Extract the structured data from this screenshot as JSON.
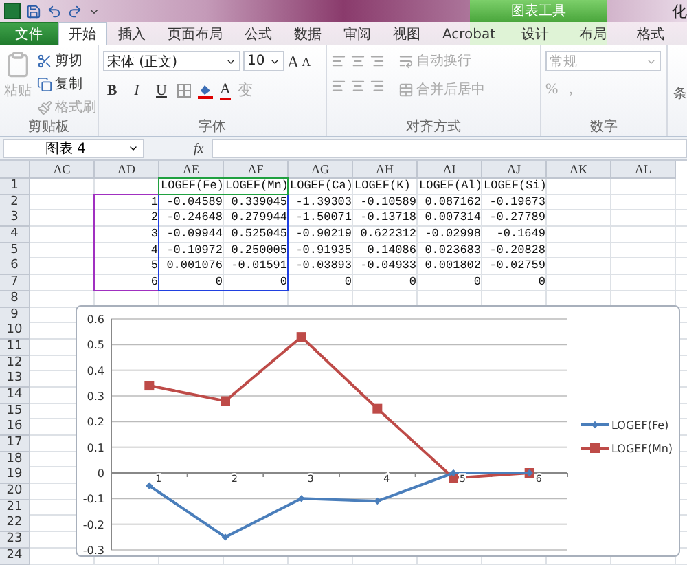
{
  "window": {
    "title": "化"
  },
  "context_tab_group": {
    "label": "图表工具"
  },
  "tabs": [
    {
      "label": "文件",
      "kind": "file",
      "selected": false
    },
    {
      "label": "开始",
      "kind": "normal",
      "selected": true
    },
    {
      "label": "插入",
      "kind": "normal",
      "selected": false
    },
    {
      "label": "页面布局",
      "kind": "normal",
      "selected": false
    },
    {
      "label": "公式",
      "kind": "normal",
      "selected": false
    },
    {
      "label": "数据",
      "kind": "normal",
      "selected": false
    },
    {
      "label": "审阅",
      "kind": "normal",
      "selected": false
    },
    {
      "label": "视图",
      "kind": "normal",
      "selected": false
    },
    {
      "label": "Acrobat",
      "kind": "normal",
      "selected": false
    },
    {
      "label": "设计",
      "kind": "context",
      "selected": false
    },
    {
      "label": "布局",
      "kind": "context",
      "selected": false
    },
    {
      "label": "格式",
      "kind": "context",
      "selected": false
    }
  ],
  "ribbon": {
    "clipboard": {
      "label": "剪贴板",
      "paste": {
        "label": "粘贴",
        "disabled": true
      },
      "items": [
        {
          "label": "剪切",
          "kind": "cut",
          "disabled": false
        },
        {
          "label": "复制",
          "kind": "copy",
          "disabled": false
        },
        {
          "label": "格式刷",
          "kind": "painter",
          "disabled": true
        }
      ]
    },
    "font": {
      "label": "字体",
      "font_name": "宋体 (正文)",
      "font_size": "10",
      "styles": [
        {
          "label": "B",
          "kind": "bold"
        },
        {
          "label": "I",
          "kind": "italic"
        },
        {
          "label": "U",
          "kind": "underline"
        }
      ],
      "grow": "A",
      "shrink": "A",
      "font_color": "A",
      "phonetic": {
        "label": "变",
        "disabled": true
      }
    },
    "alignment": {
      "label": "对齐方式",
      "wrap": {
        "label": "自动换行",
        "disabled": true
      },
      "merge": {
        "label": "合并后居中",
        "disabled": true
      }
    },
    "number": {
      "label": "数字",
      "format": {
        "label": "常规",
        "disabled": true
      },
      "percent": "%",
      "comma": ","
    },
    "partial_group_label": "条"
  },
  "formula_bar": {
    "name_box": "图表 4",
    "function_label": "fx"
  },
  "sheet": {
    "columns": [
      "AC",
      "AD",
      "AE",
      "AF",
      "AG",
      "AH",
      "AI",
      "AJ",
      "AK",
      "AL"
    ],
    "rows": [
      {
        "number": "1",
        "labels": [
          "LOGEF(Fe)",
          "LOGEF(Mn)",
          "LOGEF(Ca)",
          "LOGEF(K)",
          "LOGEF(Al)",
          "LOGEF(Si)"
        ]
      },
      {
        "number": "2",
        "category": "1",
        "values": [
          "-0.04589",
          "0.339045",
          "-1.39303",
          "-0.10589",
          "0.087162",
          "-0.19673"
        ]
      },
      {
        "number": "3",
        "category": "2",
        "values": [
          "-0.24648",
          "0.279944",
          "-1.50071",
          "-0.13718",
          "0.007314",
          "-0.27789"
        ]
      },
      {
        "number": "4",
        "category": "3",
        "values": [
          "-0.09944",
          "0.525045",
          "-0.90219",
          "0.622312",
          "-0.02998",
          "-0.1649"
        ]
      },
      {
        "number": "5",
        "category": "4",
        "values": [
          "-0.10972",
          "0.250005",
          "-0.91935",
          "0.14086",
          "0.023683",
          "-0.20828"
        ]
      },
      {
        "number": "6",
        "category": "5",
        "values": [
          "0.001076",
          "-0.01591",
          "-0.03893",
          "-0.04933",
          "0.001802",
          "-0.02759"
        ]
      },
      {
        "number": "7",
        "category": "6",
        "values": [
          "0",
          "0",
          "0",
          "0",
          "0",
          "0"
        ]
      },
      {
        "number": "8"
      },
      {
        "number": "9"
      },
      {
        "number": "10"
      },
      {
        "number": "11"
      },
      {
        "number": "12"
      },
      {
        "number": "13"
      },
      {
        "number": "14"
      },
      {
        "number": "15"
      },
      {
        "number": "16"
      },
      {
        "number": "17"
      },
      {
        "number": "18"
      },
      {
        "number": "19"
      },
      {
        "number": "20"
      },
      {
        "number": "21"
      },
      {
        "number": "22"
      },
      {
        "number": "23"
      },
      {
        "number": "24"
      }
    ]
  },
  "chart": {
    "chart_data": {
      "type": "line",
      "categories": [
        "1",
        "2",
        "3",
        "4",
        "5",
        "6"
      ],
      "grid": true,
      "legend": true,
      "series": [
        {
          "name": "LOGEF(Fe)",
          "color": "#4a7ebb",
          "marker": "diamond",
          "values": [
            -0.05,
            -0.25,
            -0.1,
            -0.11,
            0,
            0
          ]
        },
        {
          "name": "LOGEF(Mn)",
          "color": "#be4b48",
          "marker": "square",
          "values": [
            0.34,
            0.28,
            0.53,
            0.25,
            -0.02,
            0
          ]
        }
      ],
      "ylim": [
        -0.3,
        0.6
      ],
      "yticks": [
        {
          "value": 0.6,
          "label": "0.6"
        },
        {
          "value": 0.5,
          "label": "0.5"
        },
        {
          "value": 0.4,
          "label": "0.4"
        },
        {
          "value": 0.3,
          "label": "0.3"
        },
        {
          "value": 0.2,
          "label": "0.2"
        },
        {
          "value": 0.1,
          "label": "0.1"
        },
        {
          "value": 0,
          "label": "0"
        },
        {
          "value": -0.1,
          "label": "-0.1"
        },
        {
          "value": -0.2,
          "label": "-0.2"
        },
        {
          "value": -0.3,
          "label": "-0.3"
        }
      ]
    }
  }
}
